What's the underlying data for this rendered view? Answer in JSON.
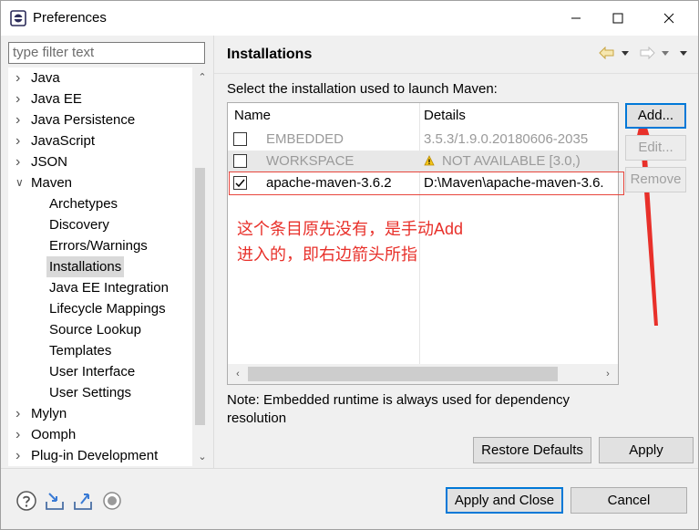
{
  "window": {
    "title": "Preferences",
    "minimize_label": "Minimize",
    "maximize_label": "Maximize",
    "close_label": "Close"
  },
  "filter": {
    "placeholder": "type filter text",
    "value": ""
  },
  "tree": {
    "items": [
      {
        "label": "Java",
        "expandable": true,
        "expanded": false,
        "level": 0
      },
      {
        "label": "Java EE",
        "expandable": true,
        "expanded": false,
        "level": 0
      },
      {
        "label": "Java Persistence",
        "expandable": true,
        "expanded": false,
        "level": 0
      },
      {
        "label": "JavaScript",
        "expandable": true,
        "expanded": false,
        "level": 0
      },
      {
        "label": "JSON",
        "expandable": true,
        "expanded": false,
        "level": 0
      },
      {
        "label": "Maven",
        "expandable": true,
        "expanded": true,
        "level": 0
      },
      {
        "label": "Archetypes",
        "level": 1
      },
      {
        "label": "Discovery",
        "level": 1
      },
      {
        "label": "Errors/Warnings",
        "level": 1
      },
      {
        "label": "Installations",
        "level": 1,
        "selected": true
      },
      {
        "label": "Java EE Integration",
        "level": 1
      },
      {
        "label": "Lifecycle Mappings",
        "level": 1
      },
      {
        "label": "Source Lookup",
        "level": 1
      },
      {
        "label": "Templates",
        "level": 1
      },
      {
        "label": "User Interface",
        "level": 1
      },
      {
        "label": "User Settings",
        "level": 1
      },
      {
        "label": "Mylyn",
        "expandable": true,
        "expanded": false,
        "level": 0
      },
      {
        "label": "Oomph",
        "expandable": true,
        "expanded": false,
        "level": 0
      },
      {
        "label": "Plug-in Development",
        "expandable": true,
        "expanded": false,
        "level": 0
      }
    ]
  },
  "page": {
    "title": "Installations",
    "description": "Select the installation used to launch Maven:",
    "table": {
      "columns": [
        "Name",
        "Details"
      ],
      "rows": [
        {
          "checked": false,
          "name": "EMBEDDED",
          "details": "3.5.3/1.9.0.20180606-2035",
          "dimmed": true,
          "warning": false
        },
        {
          "checked": false,
          "name": "WORKSPACE",
          "details": "NOT AVAILABLE [3.0,)",
          "dimmed": true,
          "warning": true
        },
        {
          "checked": true,
          "name": "apache-maven-3.6.2",
          "details": "D:\\Maven\\apache-maven-3.6.",
          "dimmed": false,
          "warning": false
        }
      ]
    },
    "buttons": {
      "add": "Add...",
      "edit": "Edit...",
      "remove": "Remove"
    },
    "note": "Note: Embedded runtime is always used for dependency resolution",
    "annotation_line1": "这个条目原先没有，是手动Add",
    "annotation_line2": "进入的，即右边箭头所指",
    "restore_defaults": "Restore Defaults",
    "apply": "Apply"
  },
  "footer": {
    "apply_and_close": "Apply and Close",
    "cancel": "Cancel",
    "icons": [
      "help-icon",
      "import-icon",
      "export-icon",
      "record-icon"
    ]
  },
  "colors": {
    "annotation": "#e8302a",
    "focus": "#0078d7",
    "selection": "#d9d9d9"
  }
}
